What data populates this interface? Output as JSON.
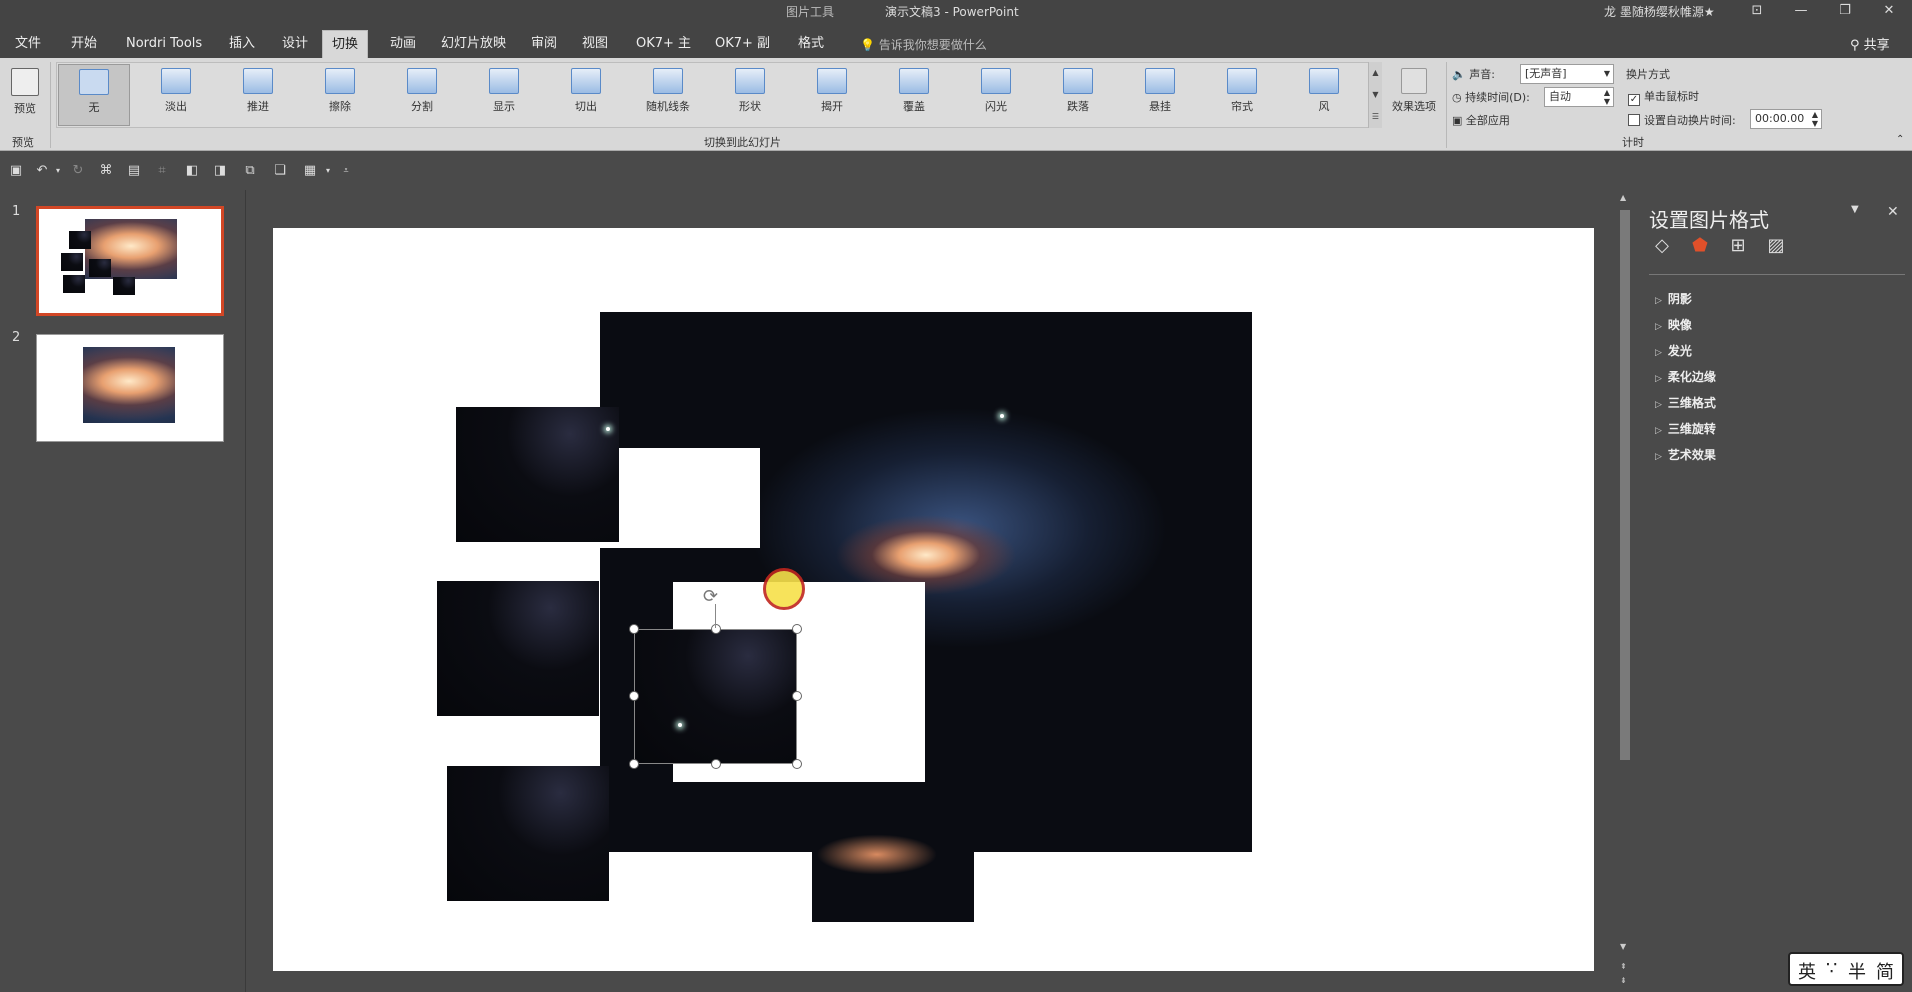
{
  "titlebar": {
    "context": "图片工具",
    "title": "演示文稿3  -  PowerPoint",
    "user": "龙 墨随杨缨秋帷源★",
    "min_icon": "—",
    "max_icon": "❐",
    "close_icon": "✕",
    "ribbon_icon": "⊡"
  },
  "tabs": [
    "文件",
    "开始",
    "Nordri Tools",
    "插入",
    "设计",
    "切换",
    "动画",
    "幻灯片放映",
    "审阅",
    "视图",
    "OK7+ 主",
    "OK7+ 副",
    "格式"
  ],
  "active_tab": "切换",
  "tellme": "告诉我你想要做什么",
  "share": "共享",
  "ribbon": {
    "preview_label": "预览",
    "preview_group": "预览",
    "transitions": [
      "无",
      "淡出",
      "推进",
      "擦除",
      "分割",
      "显示",
      "切出",
      "随机线条",
      "形状",
      "揭开",
      "覆盖",
      "闪光",
      "跌落",
      "悬挂",
      "帘式",
      "风"
    ],
    "selected_transition": "无",
    "effect_options": "效果选项",
    "transition_group": "切换到此幻灯片",
    "sound_label": "声音:",
    "sound_value": "[无声音]",
    "duration_label": "持续时间(D):",
    "duration_value": "自动",
    "apply_all": "全部应用",
    "advance_title": "换片方式",
    "on_click": "单击鼠标时",
    "auto_after": "设置自动换片时间:",
    "auto_time": "00:00.00",
    "timing_group": "计时"
  },
  "thumbnails": [
    {
      "num": "1"
    },
    {
      "num": "2"
    }
  ],
  "format_pane": {
    "title": "设置图片格式",
    "sections": [
      "阴影",
      "映像",
      "发光",
      "柔化边缘",
      "三维格式",
      "三维旋转",
      "艺术效果"
    ]
  },
  "ime": {
    "a": "英",
    "b": "∵",
    "c": "半",
    "d": "简"
  }
}
